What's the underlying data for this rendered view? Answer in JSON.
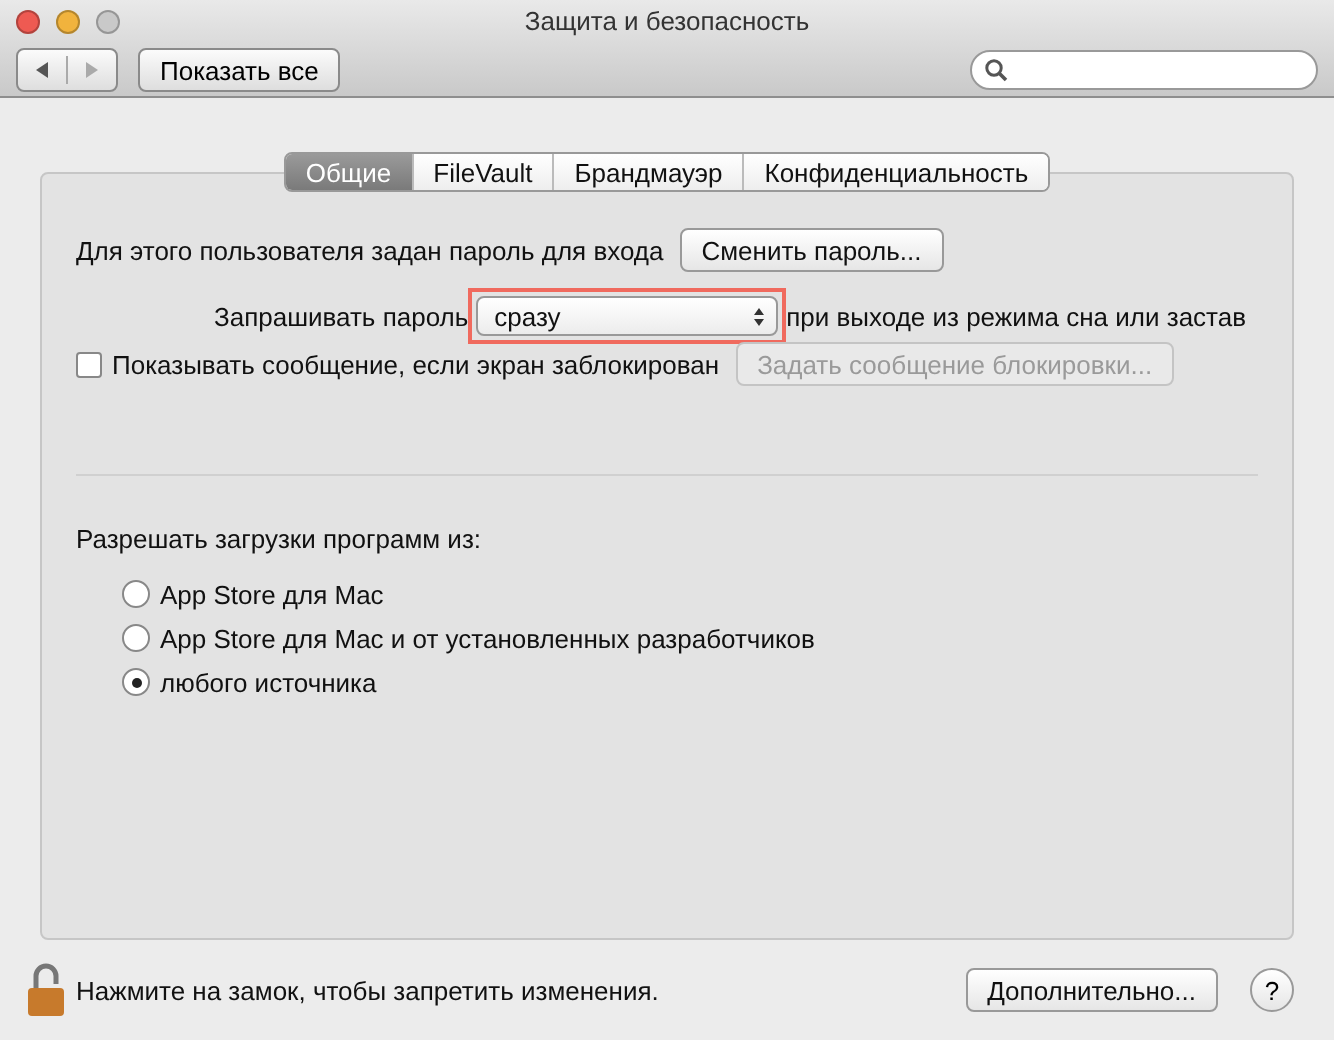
{
  "window": {
    "title": "Защита и безопасность",
    "buttons": [
      {
        "kind": "close"
      },
      {
        "kind": "minimize"
      },
      {
        "kind": "zoom"
      }
    ]
  },
  "toolbar": {
    "back_disabled": false,
    "forward_disabled": true,
    "show_all": "Показать все"
  },
  "tabs": [
    {
      "label": "Общие",
      "selected": true
    },
    {
      "label": "FileVault",
      "selected": false
    },
    {
      "label": "Брандмауэр",
      "selected": false
    },
    {
      "label": "Конфиденциальность",
      "selected": false
    }
  ],
  "password": {
    "label": "Для этого пользователя задан пароль для входа",
    "button": "Сменить пароль..."
  },
  "require": {
    "label": "Запрашивать пароль",
    "value": "сразу",
    "highlighted": true,
    "suffix": "при выходе из режима сна или застав"
  },
  "message": {
    "label": "Показывать сообщение, если экран заблокирован",
    "checked": false,
    "button": "Задать сообщение блокировки...",
    "button_disabled": true
  },
  "downloads": {
    "label": "Разрешать загрузки программ из:",
    "options": [
      {
        "label": "App Store для Mac",
        "selected": false
      },
      {
        "label": "App Store для Mac и от установленных разработчиков",
        "selected": false
      },
      {
        "label": "любого источника",
        "selected": true
      }
    ]
  },
  "footer": {
    "lock_text": "Нажмите на замок, чтобы запретить изменения.",
    "advanced": "Дополнительно...",
    "help": "?"
  }
}
